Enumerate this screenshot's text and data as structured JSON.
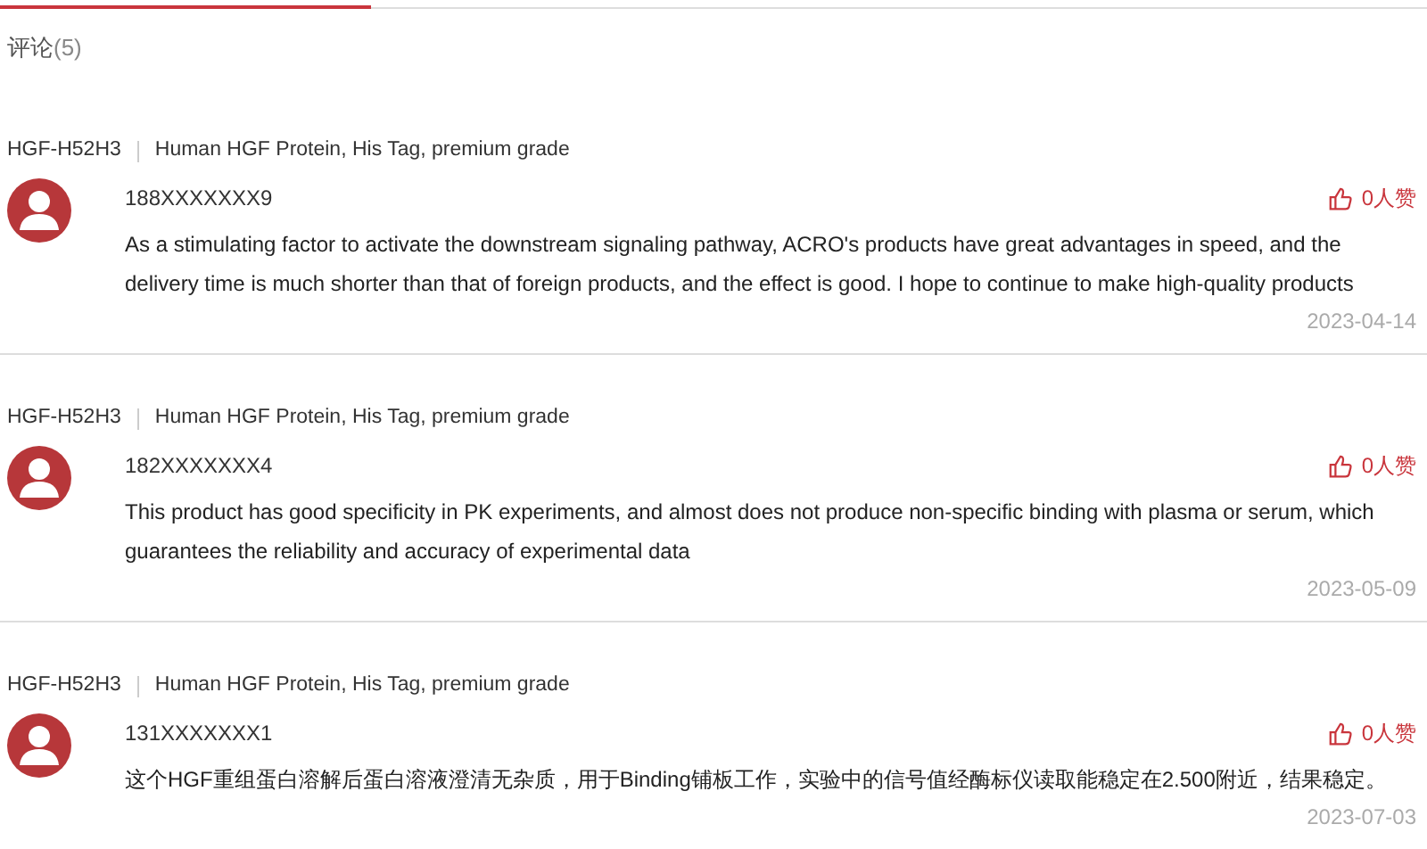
{
  "title": "评论",
  "count": "(5)",
  "reviews": [
    {
      "sku": "HGF-H52H3",
      "product": "Human HGF Protein, His Tag, premium grade",
      "user": "188XXXXXXX9",
      "likes": "0人赞",
      "text": "As a stimulating factor to activate the downstream signaling pathway, ACRO's products have great advantages in speed, and the delivery time is much shorter than that of foreign products, and the effect is good. I hope to continue to make high-quality products",
      "date": "2023-04-14"
    },
    {
      "sku": "HGF-H52H3",
      "product": "Human HGF Protein, His Tag, premium grade",
      "user": "182XXXXXXX4",
      "likes": "0人赞",
      "text": "This product has good specificity in PK experiments, and almost does not produce non-specific binding with plasma or serum, which guarantees the reliability and accuracy of experimental data",
      "date": "2023-05-09"
    },
    {
      "sku": "HGF-H52H3",
      "product": "Human HGF Protein, His Tag, premium grade",
      "user": "131XXXXXXX1",
      "likes": "0人赞",
      "text": "这个HGF重组蛋白溶解后蛋白溶液澄清无杂质，用于Binding铺板工作，实验中的信号值经酶标仪读取能稳定在2.500附近，结果稳定。",
      "date": "2023-07-03"
    }
  ]
}
